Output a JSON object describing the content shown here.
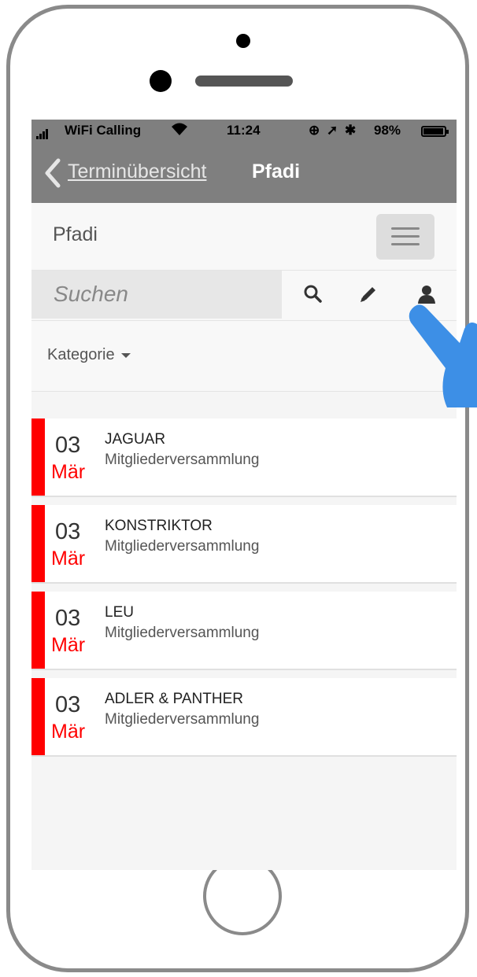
{
  "status_bar": {
    "carrier": "WiFi Calling",
    "time": "11:24",
    "battery": "98%",
    "icons": [
      "signal-icon",
      "wifi-icon",
      "orientation-lock-icon",
      "location-icon",
      "bluetooth-icon",
      "battery-icon"
    ]
  },
  "nav": {
    "back_label": "Terminübersicht",
    "title": "Pfadi"
  },
  "header": {
    "brand": "Pfadi",
    "menu_icon": "hamburger-icon"
  },
  "toolbar": {
    "search_placeholder": "Suchen",
    "icons": [
      "search-icon",
      "pencil-icon",
      "user-icon"
    ]
  },
  "filter": {
    "category_label": "Kategorie"
  },
  "events": [
    {
      "day": "03",
      "month": "Mär",
      "name": "JAGUAR",
      "subtitle": "Mitgliederversammlung"
    },
    {
      "day": "03",
      "month": "Mär",
      "name": "KONSTRIKTOR",
      "subtitle": "Mitgliederversammlung"
    },
    {
      "day": "03",
      "month": "Mär",
      "name": "LEU",
      "subtitle": "Mitgliederversammlung"
    },
    {
      "day": "03",
      "month": "Mär",
      "name": "ADLER & PANTHER",
      "subtitle": "Mitgliederversammlung"
    }
  ],
  "colors": {
    "accent": "#ff0000",
    "navbar": "#7f7f7f",
    "pointer": "#3d8fe6"
  }
}
